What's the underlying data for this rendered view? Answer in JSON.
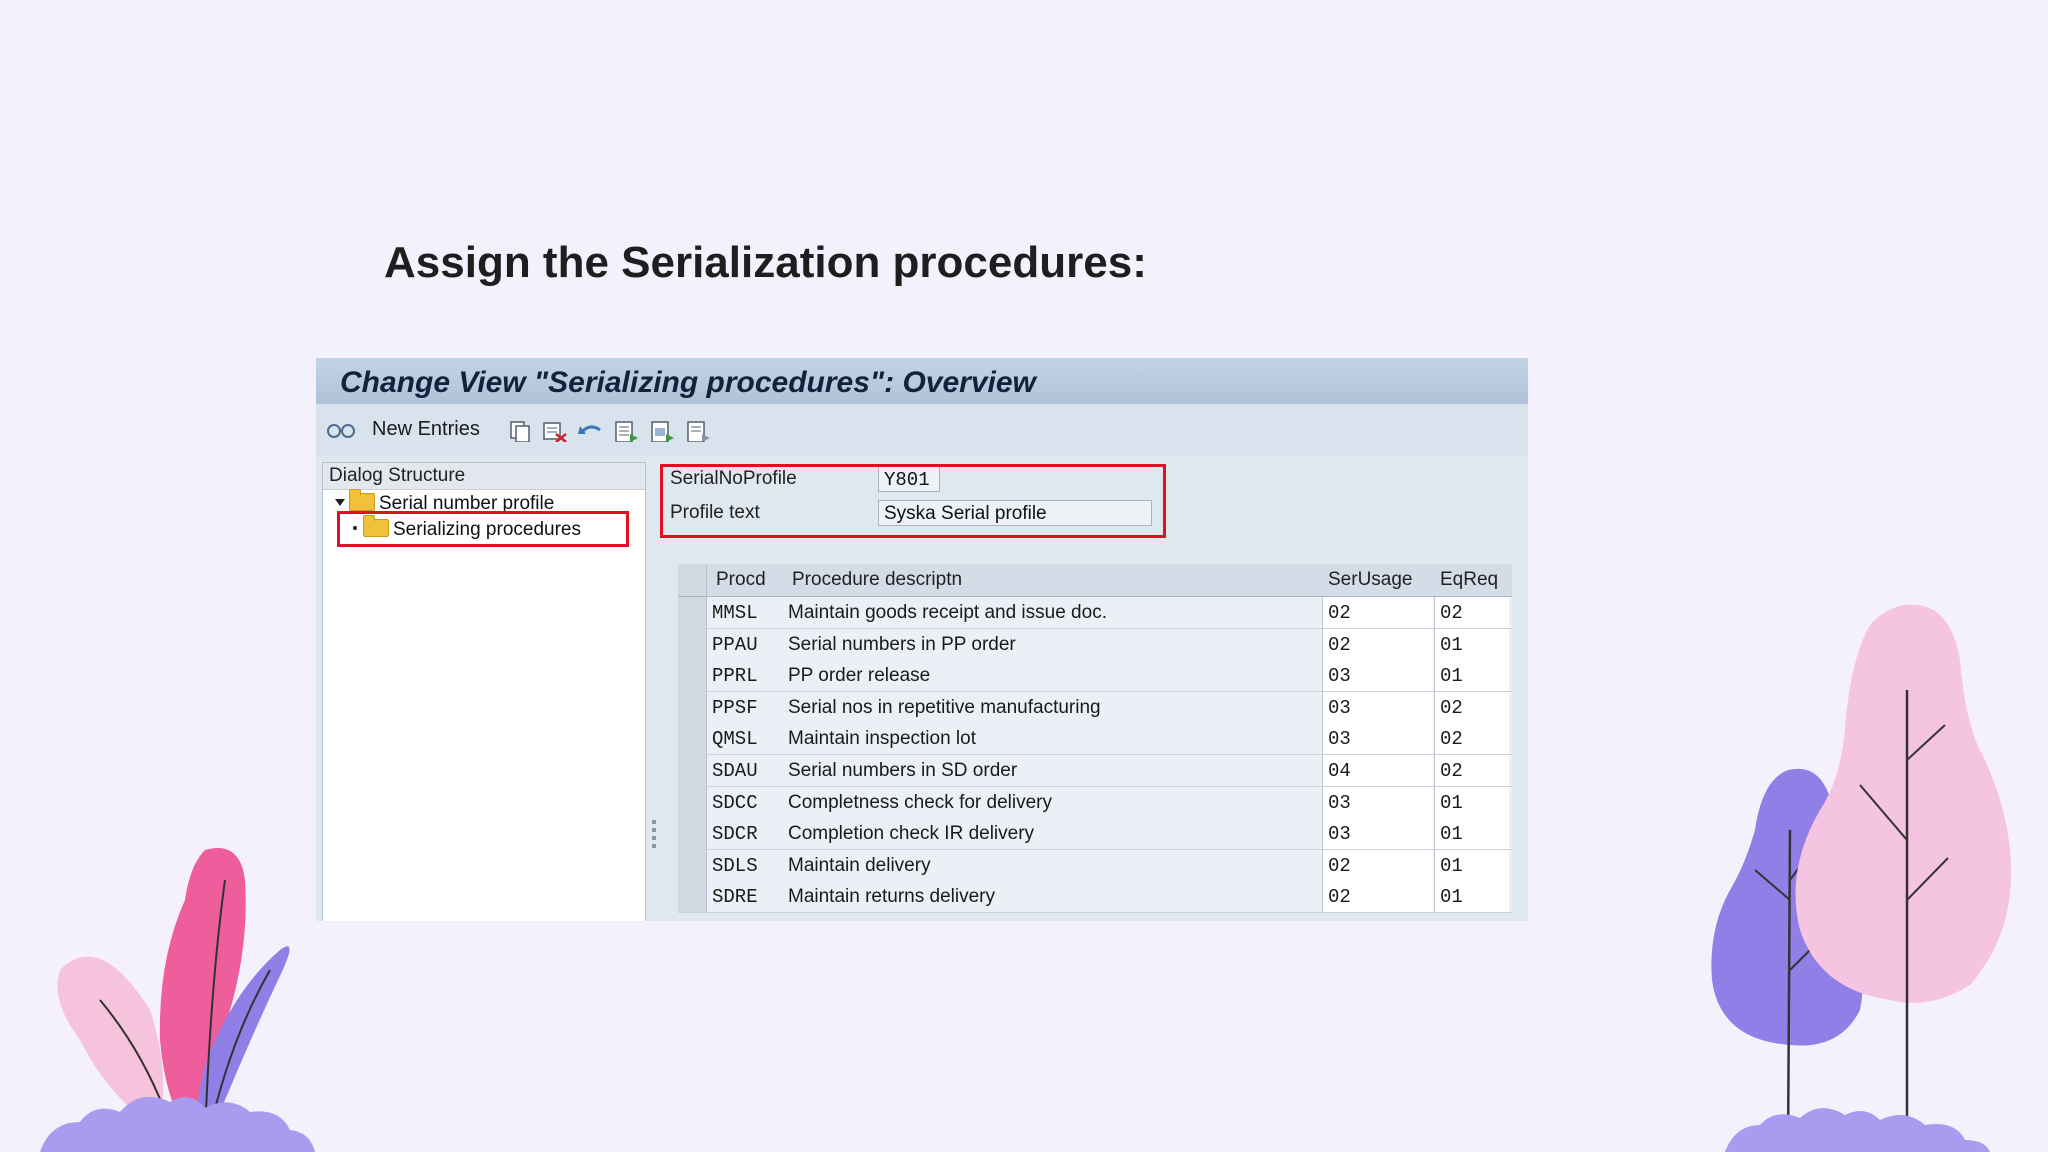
{
  "slide": {
    "title": "Assign the Serialization procedures:"
  },
  "sap": {
    "window_title": "Change View \"Serializing procedures\": Overview",
    "toolbar": {
      "new_entries_label": "New Entries",
      "icons": [
        "edit-glasses-icon",
        "copy-icon",
        "delete-icon",
        "undo-icon",
        "select-all-icon",
        "select-block-icon",
        "deselect-icon"
      ]
    },
    "dialog_structure": {
      "heading": "Dialog Structure",
      "items": [
        {
          "label": "Serial number profile",
          "expanded": true
        },
        {
          "label": "Serializing procedures",
          "selected": true
        }
      ]
    },
    "header": {
      "serial_profile_label": "SerialNoProfile",
      "serial_profile_value": "Y801",
      "profile_text_label": "Profile text",
      "profile_text_value": "Syska Serial profile"
    },
    "table": {
      "columns": [
        "Procd",
        "Procedure descriptn",
        "SerUsage",
        "EqReq"
      ],
      "rows": [
        {
          "procd": "MMSL",
          "desc": "Maintain goods receipt and issue doc.",
          "usage": "02",
          "eqreq": "02"
        },
        {
          "procd": "PPAU",
          "desc": "Serial numbers in PP order",
          "usage": "02",
          "eqreq": "01"
        },
        {
          "procd": "PPRL",
          "desc": "PP order release",
          "usage": "03",
          "eqreq": "01"
        },
        {
          "procd": "PPSF",
          "desc": "Serial nos in repetitive manufacturing",
          "usage": "03",
          "eqreq": "02"
        },
        {
          "procd": "QMSL",
          "desc": "Maintain inspection lot",
          "usage": "03",
          "eqreq": "02"
        },
        {
          "procd": "SDAU",
          "desc": "Serial numbers in SD order",
          "usage": "04",
          "eqreq": "02"
        },
        {
          "procd": "SDCC",
          "desc": "Completness check for delivery",
          "usage": "03",
          "eqreq": "01"
        },
        {
          "procd": "SDCR",
          "desc": "Completion check IR delivery",
          "usage": "03",
          "eqreq": "01"
        },
        {
          "procd": "SDLS",
          "desc": "Maintain delivery",
          "usage": "02",
          "eqreq": "01"
        },
        {
          "procd": "SDRE",
          "desc": "Maintain returns delivery",
          "usage": "02",
          "eqreq": "01"
        }
      ]
    }
  },
  "colors": {
    "highlight_red": "#e01020",
    "background": "#f5f1fc",
    "tree_pink": "#f5c4e0",
    "tree_purple": "#8f7fe6",
    "leaf_pink": "#ef5e9c"
  }
}
